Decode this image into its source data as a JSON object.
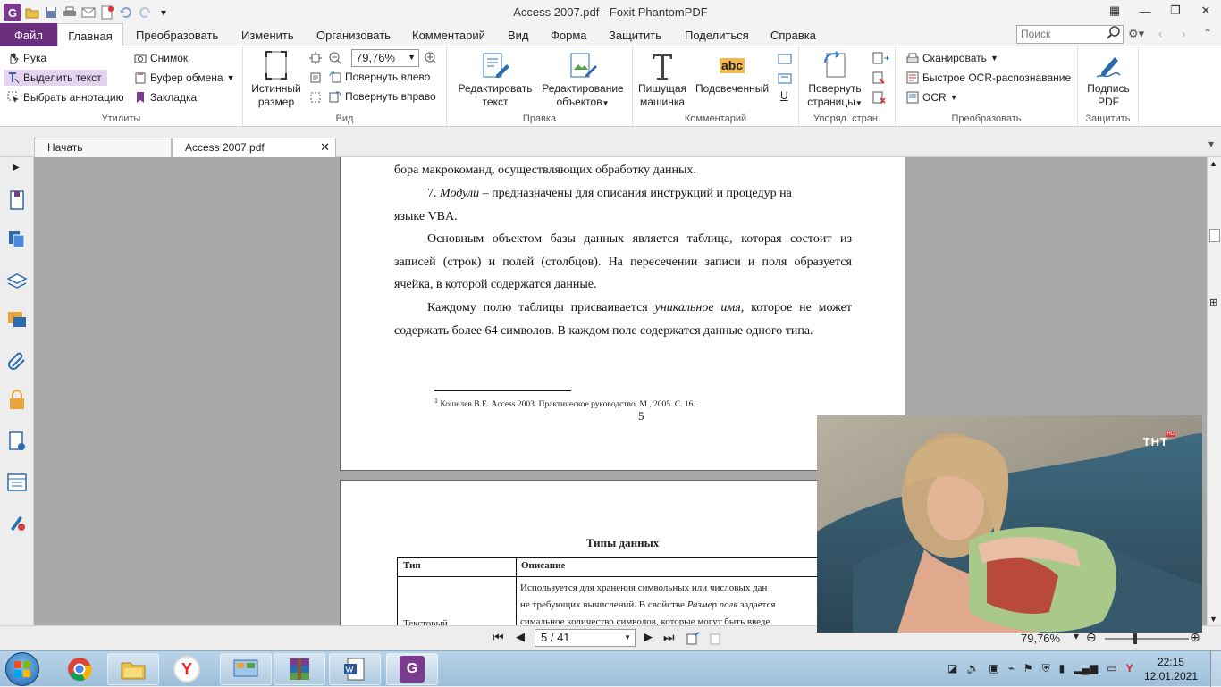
{
  "window": {
    "title": "Access 2007.pdf - Foxit PhantomPDF"
  },
  "menu": {
    "file": "Файл",
    "tabs": [
      "Главная",
      "Преобразовать",
      "Изменить",
      "Организовать",
      "Комментарий",
      "Вид",
      "Форма",
      "Защитить",
      "Поделиться",
      "Справка"
    ],
    "search_placeholder": "Поиск"
  },
  "ribbon": {
    "utilities": {
      "label": "Утилиты",
      "hand": "Рука",
      "select_text": "Выделить текст",
      "select_annotation": "Выбрать аннотацию",
      "snapshot": "Снимок",
      "clipboard": "Буфер обмена",
      "bookmark": "Закладка"
    },
    "view": {
      "label": "Вид",
      "actual_size_1": "Истинный",
      "actual_size_2": "размер",
      "zoom": "79,76%",
      "rotate_left": "Повернуть влево",
      "rotate_right": "Повернуть вправо"
    },
    "edit": {
      "label": "Правка",
      "edit_text_1": "Редактировать",
      "edit_text_2": "текст",
      "edit_objects_1": "Редактирование",
      "edit_objects_2": "объектов"
    },
    "comment": {
      "label": "Комментарий",
      "typewriter_1": "Пишущая",
      "typewriter_2": "машинка",
      "highlight": "Подсвеченный",
      "highlight_icon_text": "abc"
    },
    "pages": {
      "label": "Упоряд. стран.",
      "rotate_pages_1": "Повернуть",
      "rotate_pages_2": "страницы"
    },
    "convert": {
      "label": "Преобразовать",
      "scan": "Сканировать",
      "quick_ocr": "Быстрое OCR-распознавание",
      "ocr": "OCR"
    },
    "protect": {
      "label": "Защитить",
      "sign_1": "Подпись",
      "sign_2": "PDF"
    }
  },
  "doc_tabs": {
    "start": "Начать",
    "doc": "Access 2007.pdf"
  },
  "page1": {
    "line0": "бора макрокоманд, осуществляющих обработку данных.",
    "p7_num": "7.",
    "p7_term": "Модули",
    "p7_rest": " – предназначены для описания инструкций и процедур на",
    "p7_line2": "языке VBA.",
    "p8": "Основным объектом базы данных является таблица, которая состоит из записей (строк) и полей (столбцов). На пересечении записи и поля образуется ячейка, в которой содержатся данные.",
    "p9_start": "Каждому полю таблицы присваивается ",
    "p9_term": "уникальное имя",
    "p9_end": ", которое не может содержать более 64 символов. В каждом поле содержатся данные одного типа.",
    "footnote_mark": "1",
    "footnote": " Кошелев В.Е. Access 2003. Практическое руководство. М., 2005. С. 16.",
    "page_number": "5"
  },
  "page2": {
    "title": "Типы данных",
    "col_type": "Тип",
    "col_desc": "Описание",
    "row1_type": "Текстовый",
    "row1_l1": "Используется для хранения символьных или числовых дан",
    "row1_l2a": "не требующих вычислений. В свойстве ",
    "row1_l2b": "Размер поля",
    "row1_l2c": " задается",
    "row1_l3": "симальное количество символов, которые могут быть введе"
  },
  "status": {
    "page": "5 / 41",
    "zoom": "79,76%"
  },
  "video": {
    "channel_logo": "ТНТ",
    "hd": "HD"
  },
  "clock": {
    "time": "22:15",
    "date": "12.01.2021"
  },
  "taskbar_icons": [
    "chrome",
    "file-explorer",
    "yandex-browser",
    "control-panel",
    "winrar",
    "word",
    "foxit-phantompdf"
  ],
  "colors": {
    "accent": "#6a2e7f",
    "selected": "#e4d3ef"
  }
}
